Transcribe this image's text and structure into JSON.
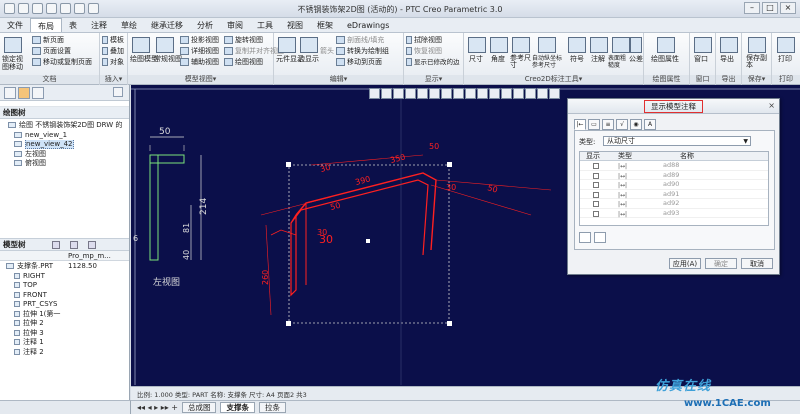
{
  "title_bar": {
    "title": "不锈钢装饰架2D图 (活动的) - PTC Creo Parametric 3.0"
  },
  "menu": [
    "文件",
    "布局",
    "表",
    "注释",
    "草绘",
    "继承迁移",
    "分析",
    "审阅",
    "工具",
    "视图",
    "框架",
    "eDrawings"
  ],
  "menu_active_index": 1,
  "ribbon": {
    "groups": [
      {
        "label": "文档",
        "buttons": [
          "新页面",
          "页面设置",
          "移动或复制页面"
        ],
        "big": "锁定视图移动"
      },
      {
        "label": "插入▾",
        "buttons": [
          "模板",
          "叠加",
          "对象"
        ]
      },
      {
        "label": "模型视图▾",
        "buttons": [
          "投影视图",
          "详细视图",
          "辅助视图",
          "旋转视图",
          "复制并对齐视图",
          "绘图视图"
        ],
        "big": [
          "绘图模型",
          "常规视图"
        ]
      },
      {
        "label": "编辑▾",
        "buttons": [
          "元件显示",
          "边显示",
          "箭头",
          "剖面线/填充",
          "转换为绘制组",
          "移动到页面"
        ]
      },
      {
        "label": "显示▾",
        "buttons": [
          "拭除视图",
          "恢复视图",
          "显示已修改的边"
        ]
      },
      {
        "label": "Creo2D标注工具▾",
        "buttons": [
          "尺寸",
          "角度",
          "参考尺寸",
          "自动纵坐标参考尺寸",
          "符号",
          "注解",
          "表面粗糙度",
          "公差"
        ]
      },
      {
        "label": "绘图属性",
        "buttons": [
          "绘图属性"
        ]
      },
      {
        "label": "窗口",
        "buttons": [
          "窗口"
        ]
      },
      {
        "label": "导出",
        "buttons": [
          "导出"
        ]
      },
      {
        "label": "保存▾",
        "buttons": [
          "保存副本"
        ]
      },
      {
        "label": "打印",
        "buttons": [
          "打印"
        ]
      }
    ]
  },
  "drawing_tree": {
    "header": "绘图树",
    "items": [
      "绘图 不锈钢装饰架2D图 DRW 的",
      "new_view_1",
      "new_view_42",
      "左视图",
      "俯视图"
    ],
    "selected_index": 2
  },
  "model_tree": {
    "header": "模型树",
    "column": "Pro_mp_m...",
    "items": [
      {
        "name": "支撑条.PRT",
        "value": "1128.50"
      },
      {
        "name": "RIGHT",
        "value": ""
      },
      {
        "name": "TOP",
        "value": ""
      },
      {
        "name": "FRONT",
        "value": ""
      },
      {
        "name": "PRT_CSYS",
        "value": ""
      },
      {
        "name": "拉伸 1(第一",
        "value": ""
      },
      {
        "name": "拉伸 2",
        "value": ""
      },
      {
        "name": "拉伸 3",
        "value": ""
      },
      {
        "name": "注释 1",
        "value": ""
      },
      {
        "name": "注释 2",
        "value": ""
      }
    ]
  },
  "drawing": {
    "dims_left": [
      "50",
      "214",
      "81",
      "40",
      "6"
    ],
    "view_label": "左视图",
    "iso_dims": [
      "30",
      "30",
      "30",
      "30",
      "50",
      "50",
      "50",
      "350",
      "390",
      "260"
    ]
  },
  "status": {
    "text": "比例: 1.000   类型: PART   名称: 支撑条   尺寸: A4   页面2 共3"
  },
  "sheets": {
    "nav": "◂◂ ◂ ▸ ▸▸ +",
    "tabs": [
      "总成图",
      "支撑条",
      "拉条"
    ],
    "active": 1
  },
  "dialog": {
    "title": "显示模型注释",
    "type_label": "类型:",
    "type_value": "从动尺寸",
    "columns": [
      "显示",
      "类型",
      "名称"
    ],
    "rows": [
      "ad88",
      "ad89",
      "ad90",
      "ad91",
      "ad92",
      "ad93"
    ],
    "buttons": [
      "应用(A)",
      "确定",
      "取消"
    ]
  },
  "watermark": {
    "text": "仿真在线",
    "url": "www.1CAE.com"
  },
  "colors": {
    "canvas": "#0b0f4a",
    "selected": "#ff2020",
    "view_lines": "#7be37b",
    "annotation_border": "#e03030"
  }
}
